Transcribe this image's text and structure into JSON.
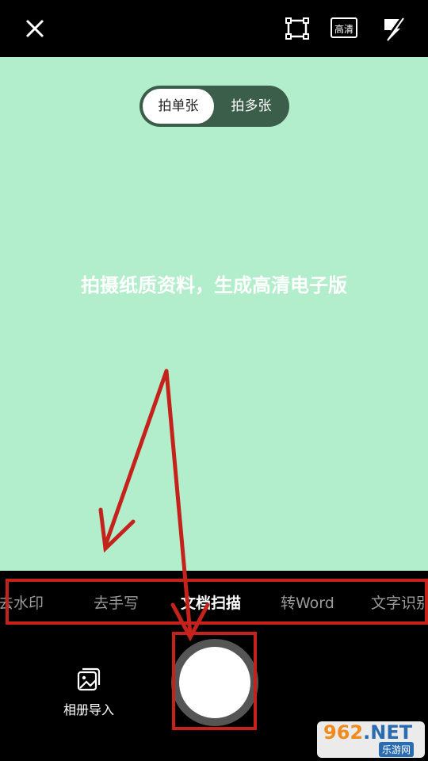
{
  "toolbar": {
    "hd_label": "高清"
  },
  "capture_mode": {
    "single": "拍单张",
    "multi": "拍多张",
    "selected": "拍单张"
  },
  "hint": "拍摄纸质资料，生成高清电子版",
  "modes": [
    {
      "label": "去水印",
      "active": false
    },
    {
      "label": "去手写",
      "active": false
    },
    {
      "label": "文档扫描",
      "active": true
    },
    {
      "label": "转Word",
      "active": false
    },
    {
      "label": "文字识别",
      "active": false
    }
  ],
  "gallery": {
    "label": "相册导入"
  },
  "watermark": {
    "brand_num": "962",
    "brand_tld": ".NET",
    "brand_cn": "乐游网"
  },
  "colors": {
    "camera_bg": "#b2eecb",
    "toggle_bg": "#3b5e4a",
    "annotation": "#c4221a"
  }
}
